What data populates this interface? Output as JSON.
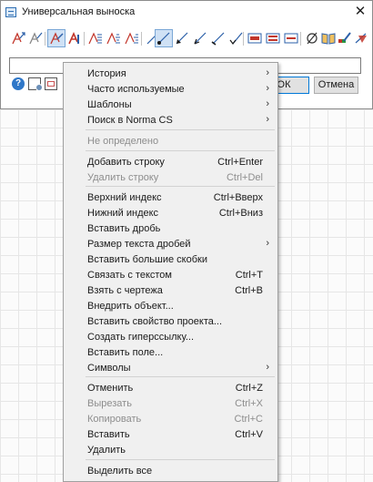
{
  "window": {
    "title": "Универсальная выноска",
    "close_glyph": "✕"
  },
  "toolbar_icons": [
    "text-arrow-up-icon",
    "text-arrow-right-icon",
    "leader-text-icon",
    "leader-text-bold-icon",
    "align-left-icon",
    "align-center-icon",
    "align-right-icon",
    "leader-line-icon",
    "leader-line-dot-icon",
    "leader-arrow-icon",
    "leader-arrow2-icon",
    "leader-arrow3-icon",
    "leader-arrow4-icon",
    "frame-red-icon",
    "frame-red2-icon",
    "frame-red3-icon",
    "diameter-icon",
    "book-icon",
    "pencil-color-icon",
    "paint-icon"
  ],
  "text_field": {
    "value": ""
  },
  "buttons": {
    "ok": "ОК",
    "cancel": "Отмена"
  },
  "menu": {
    "items": [
      {
        "label": "История",
        "submenu": true
      },
      {
        "label": "Часто используемые",
        "submenu": true
      },
      {
        "label": "Шаблоны",
        "submenu": true
      },
      {
        "label": "Поиск в Norma CS",
        "submenu": true
      },
      {
        "label": "Не определено",
        "disabled": true
      },
      {
        "label": "Добавить строку",
        "shortcut": "Ctrl+Enter"
      },
      {
        "label": "Удалить строку",
        "shortcut": "Ctrl+Del",
        "disabled": true
      },
      {
        "label": "Верхний индекс",
        "shortcut": "Ctrl+Вверх"
      },
      {
        "label": "Нижний индекс",
        "shortcut": "Ctrl+Вниз"
      },
      {
        "label": "Вставить дробь"
      },
      {
        "label": "Размер текста дробей",
        "submenu": true
      },
      {
        "label": "Вставить большие скобки"
      },
      {
        "label": "Связать с текстом",
        "shortcut": "Ctrl+T"
      },
      {
        "label": "Взять с чертежа",
        "shortcut": "Ctrl+B"
      },
      {
        "label": "Внедрить объект..."
      },
      {
        "label": "Вставить свойство проекта..."
      },
      {
        "label": "Создать гиперссылку..."
      },
      {
        "label": "Вставить поле..."
      },
      {
        "label": "Символы",
        "submenu": true
      },
      {
        "label": "Отменить",
        "shortcut": "Ctrl+Z"
      },
      {
        "label": "Вырезать",
        "shortcut": "Ctrl+X",
        "disabled": true
      },
      {
        "label": "Копировать",
        "shortcut": "Ctrl+C",
        "disabled": true
      },
      {
        "label": "Вставить",
        "shortcut": "Ctrl+V"
      },
      {
        "label": "Удалить"
      },
      {
        "label": "Выделить все"
      }
    ],
    "submenu_arrow": "›"
  },
  "colors": {
    "accent": "#0078d7",
    "menu_bg": "#f0f0f0",
    "disabled_text": "#8d8d8d"
  }
}
